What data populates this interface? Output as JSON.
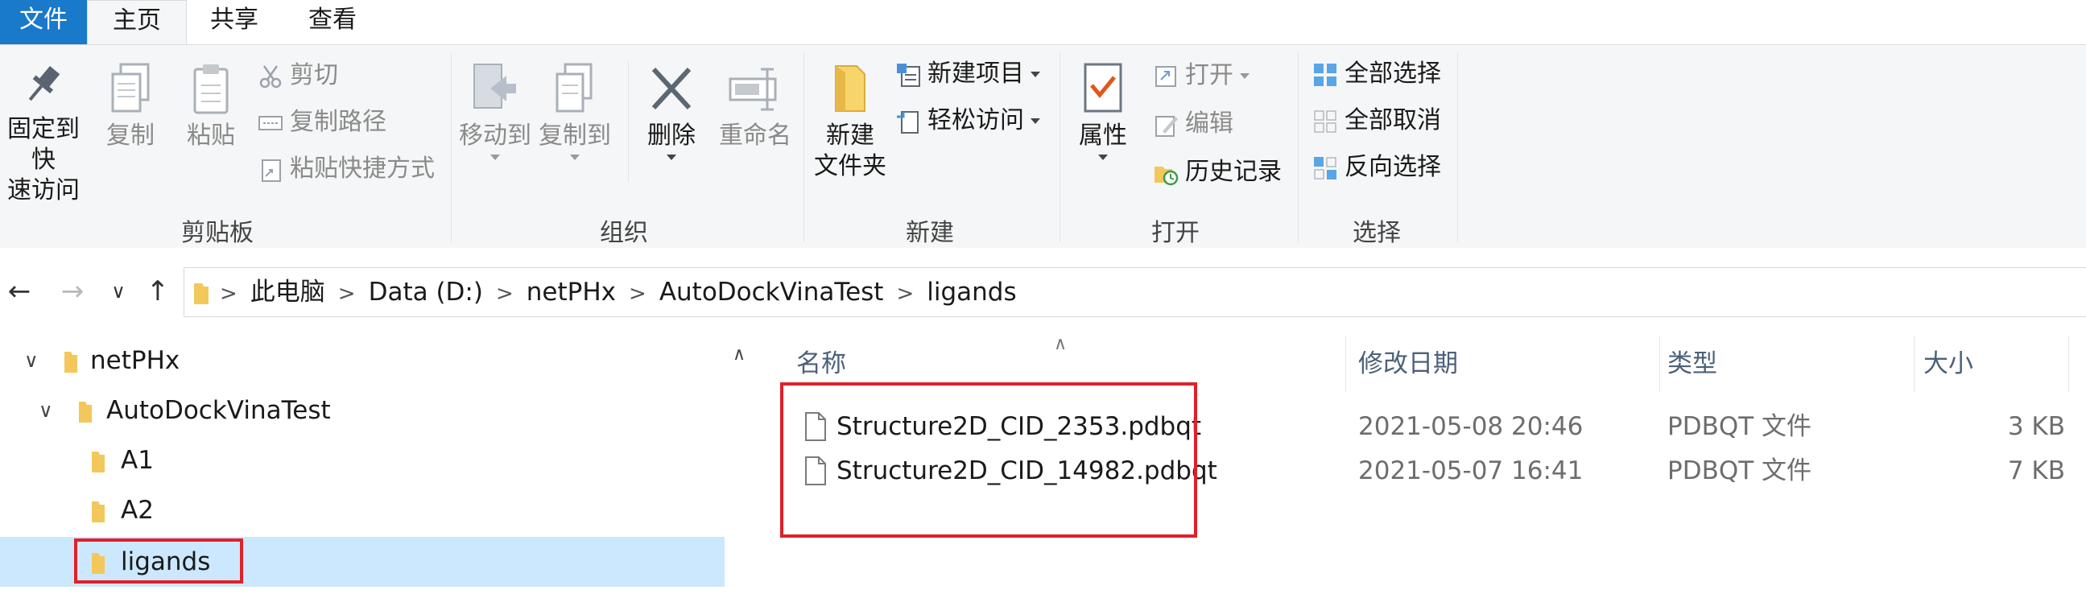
{
  "tabs": {
    "file": "文件",
    "home": "主页",
    "share": "共享",
    "view": "查看"
  },
  "ribbon": {
    "clipboard": {
      "group_label": "剪贴板",
      "pin_line1": "固定到快",
      "pin_line2": "速访问",
      "copy": "复制",
      "paste": "粘贴",
      "cut": "剪切",
      "copy_path": "复制路径",
      "paste_shortcut": "粘贴快捷方式"
    },
    "organize": {
      "group_label": "组织",
      "move_to": "移动到",
      "copy_to": "复制到",
      "delete": "删除",
      "rename": "重命名"
    },
    "new": {
      "group_label": "新建",
      "new_folder_line1": "新建",
      "new_folder_line2": "文件夹",
      "new_item": "新建项目",
      "easy_access": "轻松访问"
    },
    "open": {
      "group_label": "打开",
      "properties": "属性",
      "open": "打开",
      "edit": "编辑",
      "history": "历史记录"
    },
    "select": {
      "group_label": "选择",
      "select_all": "全部选择",
      "select_none": "全部取消",
      "invert": "反向选择"
    }
  },
  "breadcrumb": [
    "此电脑",
    "Data (D:)",
    "netPHx",
    "AutoDockVinaTest",
    "ligands"
  ],
  "tree": [
    {
      "label": "netPHx",
      "expanded": true
    },
    {
      "label": "AutoDockVinaTest",
      "expanded": true
    },
    {
      "label": "A1",
      "expanded": false
    },
    {
      "label": "A2",
      "expanded": false
    },
    {
      "label": "ligands",
      "selected": true
    }
  ],
  "columns": {
    "name": "名称",
    "modified": "修改日期",
    "type": "类型",
    "size": "大小"
  },
  "files": [
    {
      "name": "Structure2D_CID_2353.pdbqt",
      "modified": "2021-05-08 20:46",
      "type": "PDBQT 文件",
      "size": "3 KB"
    },
    {
      "name": "Structure2D_CID_14982.pdbqt",
      "modified": "2021-05-07 16:41",
      "type": "PDBQT 文件",
      "size": "7 KB"
    }
  ],
  "colors": {
    "accent": "#1979ca",
    "selection": "#cce8ff",
    "highlight_box": "#e0202a",
    "folder": "#f2c85b"
  }
}
